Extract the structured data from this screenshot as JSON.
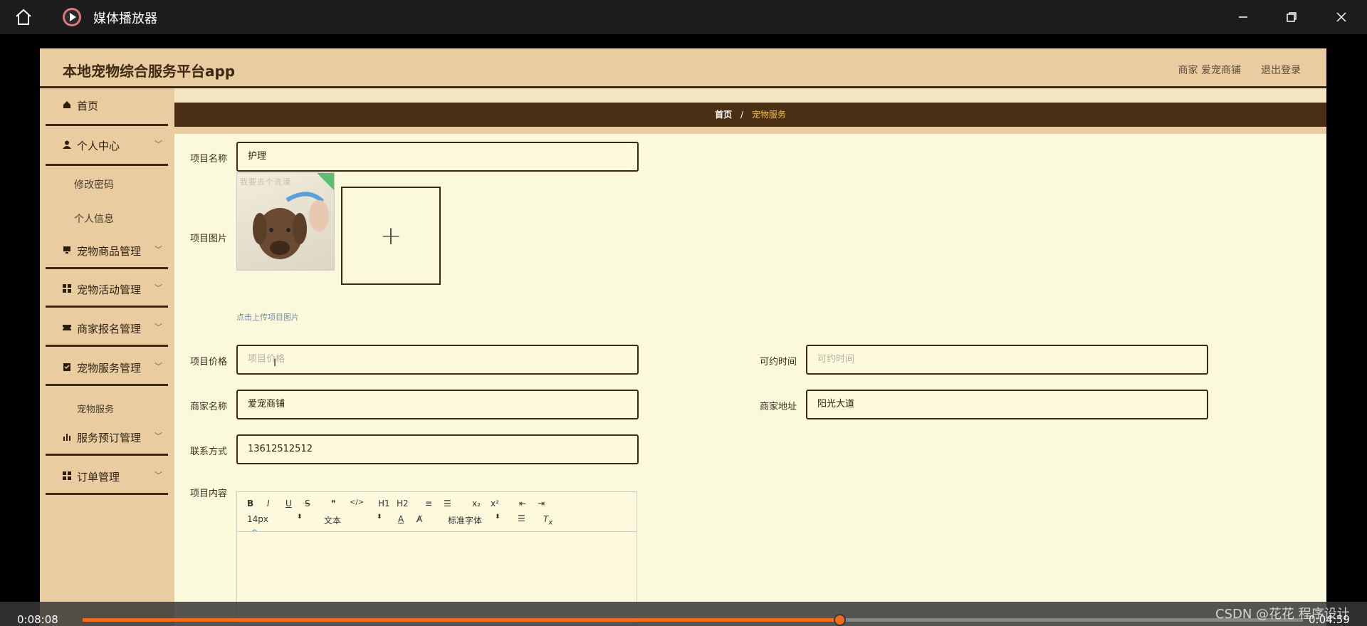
{
  "window": {
    "title": "媒体播放器"
  },
  "app": {
    "brand": "本地宠物综合服务平台app",
    "user_label": "商家 爱宠商铺",
    "logout_label": "退出登录"
  },
  "sidebar": {
    "home": "首页",
    "personal": "个人中心",
    "personal_sub": [
      "修改密码",
      "个人信息"
    ],
    "goods": "宠物商品管理",
    "activity": "宠物活动管理",
    "merchant_reg": "商家报名管理",
    "service": "宠物服务管理",
    "service_sub": [
      "宠物服务"
    ],
    "booking": "服务预订管理",
    "orders": "订单管理"
  },
  "breadcrumb": {
    "home": "首页",
    "sep": "/",
    "current": "宠物服务"
  },
  "form": {
    "name_label": "项目名称",
    "name_value": "护理",
    "image_label": "项目图片",
    "image_caption": "我要去个洗澡",
    "upload_hint": "点击上传项目图片",
    "upload_plus": "+",
    "price_label": "项目价格",
    "price_placeholder": "项目价格",
    "time_label": "可约时间",
    "time_placeholder": "可约时间",
    "merchant_label": "商家名称",
    "merchant_value": "爱宠商铺",
    "address_label": "商家地址",
    "address_value": "阳光大道",
    "contact_label": "联系方式",
    "contact_value": "13612512512",
    "content_label": "项目内容"
  },
  "editor": {
    "font_size": "14px",
    "block_type": "文本",
    "font_family": "标准字体",
    "tools_row1": [
      "B",
      "I",
      "U",
      "S",
      "❞",
      "</>",
      "H1",
      "H2",
      "≡",
      "☰",
      "x₂",
      "x²",
      "⇤",
      "⇥"
    ]
  },
  "player": {
    "elapsed": "0:08:08",
    "remaining": "0:04:59",
    "progress": 0.62,
    "watermark": "CSDN @花花 程序设计"
  },
  "colors": {
    "header_bg": "#e9cda1",
    "content_bg": "#fbf9dc",
    "dark_brown": "#3e2a12",
    "breadbar_bg": "#4a2f14",
    "accent": "#f26b1d"
  }
}
